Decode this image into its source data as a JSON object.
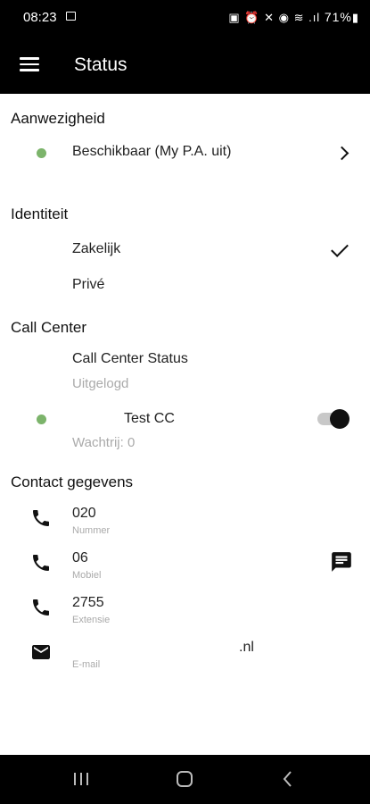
{
  "status_bar": {
    "time": "08:23",
    "battery": "71%"
  },
  "app_bar": {
    "title": "Status"
  },
  "presence": {
    "section_title": "Aanwezigheid",
    "status_label": "Beschikbaar (My P.A. uit)",
    "status_color": "#7cb46b"
  },
  "identity": {
    "section_title": "Identiteit",
    "options": [
      {
        "label": "Zakelijk",
        "selected": true
      },
      {
        "label": "Privé",
        "selected": false
      }
    ]
  },
  "call_center": {
    "section_title": "Call Center",
    "status_title": "Call Center Status",
    "status_value": "Uitgelogd",
    "queue_name": "Test CC",
    "queue_wait": "Wachtrij: 0",
    "queue_enabled": true
  },
  "contact": {
    "section_title": "Contact gegevens",
    "items": [
      {
        "value": "020",
        "label": "Nummer",
        "icon": "phone-icon"
      },
      {
        "value": "06",
        "label": "Mobiel",
        "icon": "phone-icon"
      },
      {
        "value": "2755",
        "label": "Extensie",
        "icon": "phone-icon"
      },
      {
        "value": ".nl",
        "label": "E-mail",
        "icon": "email-icon"
      }
    ]
  }
}
